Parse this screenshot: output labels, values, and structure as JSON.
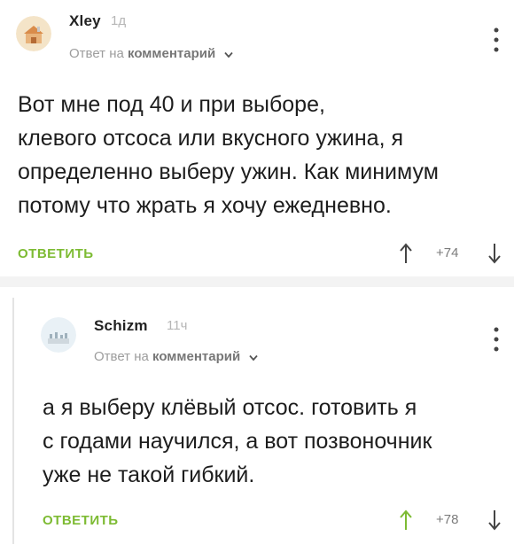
{
  "comments": [
    {
      "username": "Xley",
      "time": "1д",
      "reply_prefix": "Ответ на",
      "reply_target": "комментарий",
      "text_lines": [
        "Вот мне под 40 и при выборе,",
        "клевого отсоса или вкусного ужина, я",
        "определенно выберу ужин. Как минимум",
        "потому что жрать я хочу ежедневно."
      ],
      "reply_action": "ОТВЕТИТЬ",
      "rating": "+74"
    },
    {
      "username": "Schizm",
      "time": "11ч",
      "reply_prefix": "Ответ на",
      "reply_target": "комментарий",
      "text_lines": [
        "а я выберу клёвый отсос.  готовить я",
        "с годами научился, а вот позвоночник",
        "уже не такой гибкий."
      ],
      "reply_action": "ОТВЕТИТЬ",
      "rating": "+78"
    }
  ],
  "colors": {
    "accent_green": "#7dbb33",
    "text": "#1d1d1d",
    "muted": "#9d9d9d"
  },
  "icons": [
    "avatar-image",
    "chevron-down-icon",
    "more-options-icon",
    "upvote-arrow-icon",
    "downvote-arrow-icon"
  ]
}
